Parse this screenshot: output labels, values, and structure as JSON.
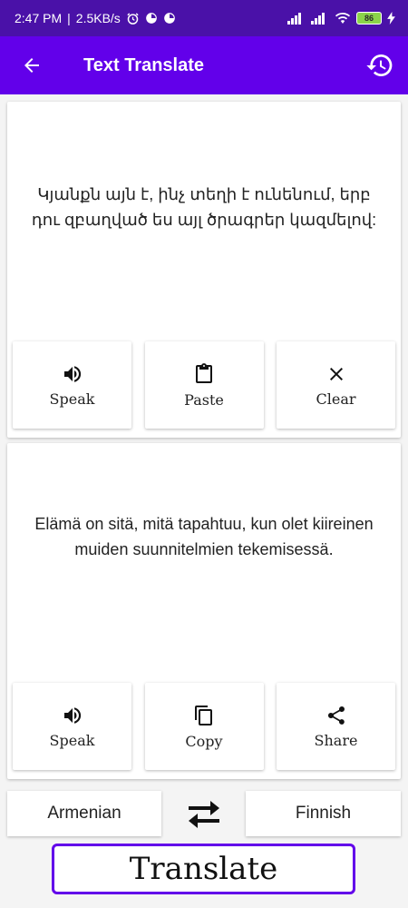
{
  "status_bar": {
    "time": "2:47 PM",
    "speed": "2.5KB/s",
    "battery": "86"
  },
  "app_bar": {
    "title": "Text Translate",
    "back_icon": "arrow-left-icon",
    "history_icon": "history-icon"
  },
  "source": {
    "text": "Կյանքն այն է, ինչ տեղի է ունենում, երբ դու զբաղված ես այլ ծրագրեր կազմելով:",
    "actions": [
      {
        "label": "Speak",
        "icon": "speaker-icon"
      },
      {
        "label": "Paste",
        "icon": "clipboard-icon"
      },
      {
        "label": "Clear",
        "icon": "close-icon"
      }
    ]
  },
  "target": {
    "text": "Elämä on sitä, mitä tapahtuu, kun olet kiireinen muiden suunnitelmien tekemisessä.",
    "actions": [
      {
        "label": "Speak",
        "icon": "speaker-icon"
      },
      {
        "label": "Copy",
        "icon": "copy-icon"
      },
      {
        "label": "Share",
        "icon": "share-icon"
      }
    ]
  },
  "languages": {
    "from": "Armenian",
    "to": "Finnish",
    "swap_icon": "swap-arrows-icon"
  },
  "translate_button": "Translate",
  "colors": {
    "status_bar": "#4a11a8",
    "app_bar": "#6200ea",
    "accent": "#6200ea",
    "background": "#f4f4f4"
  }
}
